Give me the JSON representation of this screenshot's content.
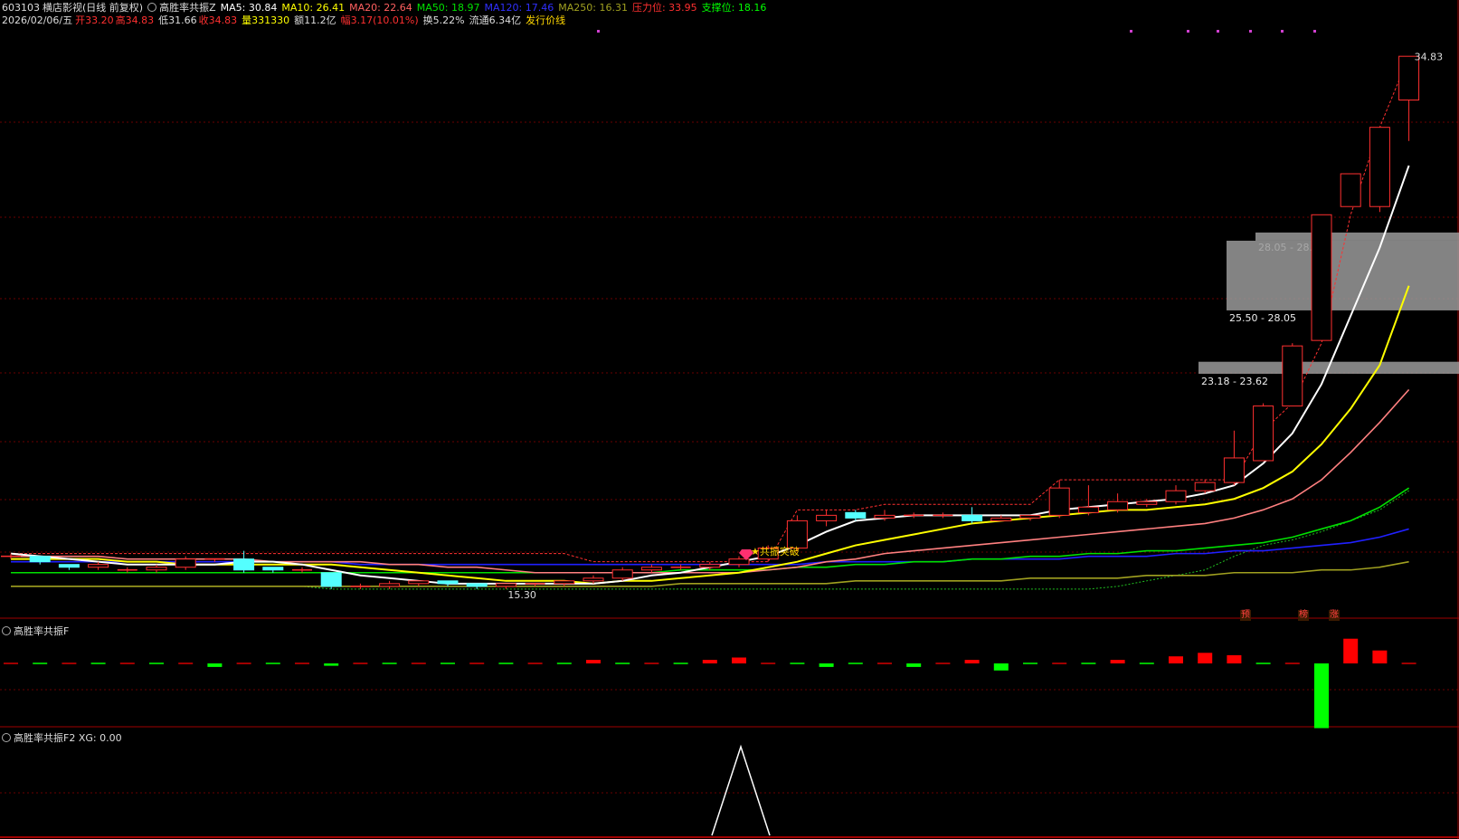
{
  "header": {
    "code": "603103",
    "name": "横店影视",
    "mode": "(日线 前复权)",
    "indicator": "高胜率共振Z",
    "ma5": "MA5: 30.84",
    "ma10": "MA10: 26.41",
    "ma20": "MA20: 22.64",
    "ma50": "MA50: 18.97",
    "ma120": "MA120: 17.46",
    "ma250": "MA250: 16.31",
    "resistance": "压力位: 33.95",
    "support": "支撑位: 18.16",
    "date": "2026/02/06/五",
    "open": "开33.20",
    "high": "高34.83",
    "low": "低31.66",
    "close": "收34.83",
    "volume": "量331330",
    "amount": "额11.2亿",
    "change": "幅3.17(10.01%)",
    "turnover": "换5.22%",
    "float": "流通6.34亿",
    "issue_line": "发行价线"
  },
  "colors": {
    "ma5": "#ffffff",
    "ma10": "#ffff00",
    "ma20": "#ff8080",
    "ma50": "#00e000",
    "ma120": "#2020ff",
    "ma250": "#a0a020",
    "up": "#ff3030",
    "down": "#54ffff",
    "grid": "#6a0000",
    "zone": "#9a9a9a"
  },
  "panels": {
    "sub1_title": "高胜率共振F",
    "sub2_title": "高胜率共振F2 XG: 0.00"
  },
  "chart_data": {
    "type": "candlestick",
    "price_labels": {
      "high": "34.83",
      "low": "15.30"
    },
    "zones": [
      {
        "label": "28.05 - 28.35",
        "lo": 28.05,
        "hi": 28.35
      },
      {
        "label": "25.50 - 28.05",
        "lo": 25.5,
        "hi": 28.05
      },
      {
        "label": "23.18 - 23.62",
        "lo": 23.18,
        "hi": 23.62
      }
    ],
    "signal_label": "共振突破",
    "tags": [
      "预",
      "榜",
      "涨"
    ],
    "candles": [
      [
        16.5,
        16.5,
        16.6,
        16.4
      ],
      [
        16.5,
        16.3,
        16.5,
        16.2
      ],
      [
        16.2,
        16.1,
        16.2,
        16.0
      ],
      [
        16.1,
        16.2,
        16.3,
        16.0
      ],
      [
        16.0,
        16.0,
        16.1,
        15.9
      ],
      [
        16.0,
        16.1,
        16.2,
        15.9
      ],
      [
        16.1,
        16.4,
        16.5,
        16.0
      ],
      [
        16.4,
        16.4,
        16.4,
        16.3
      ],
      [
        16.4,
        16.0,
        16.7,
        15.9
      ],
      [
        16.1,
        16.0,
        16.1,
        15.9
      ],
      [
        16.0,
        16.0,
        16.1,
        15.9
      ],
      [
        15.9,
        15.4,
        15.9,
        15.3
      ],
      [
        15.4,
        15.4,
        15.5,
        15.3
      ],
      [
        15.4,
        15.5,
        15.6,
        15.3
      ],
      [
        15.5,
        15.6,
        15.6,
        15.4
      ],
      [
        15.6,
        15.5,
        15.6,
        15.4
      ],
      [
        15.5,
        15.4,
        15.5,
        15.3
      ],
      [
        15.4,
        15.5,
        15.5,
        15.3
      ],
      [
        15.5,
        15.5,
        15.5,
        15.4
      ],
      [
        15.5,
        15.6,
        15.6,
        15.4
      ],
      [
        15.6,
        15.7,
        15.8,
        15.5
      ],
      [
        15.7,
        16.0,
        16.1,
        15.6
      ],
      [
        16.0,
        16.1,
        16.2,
        15.9
      ],
      [
        16.1,
        16.1,
        16.2,
        16.0
      ],
      [
        16.1,
        16.2,
        16.3,
        16.0
      ],
      [
        16.2,
        16.4,
        16.5,
        16.1
      ],
      [
        16.4,
        16.8,
        16.9,
        16.3
      ],
      [
        16.8,
        17.8,
        18.0,
        16.7
      ],
      [
        17.8,
        18.0,
        18.2,
        17.6
      ],
      [
        18.1,
        17.9,
        18.2,
        17.8
      ],
      [
        17.9,
        18.0,
        18.2,
        17.8
      ],
      [
        18.0,
        18.0,
        18.1,
        17.9
      ],
      [
        18.0,
        18.0,
        18.1,
        17.9
      ],
      [
        18.0,
        17.8,
        18.3,
        17.7
      ],
      [
        17.8,
        17.9,
        18.0,
        17.8
      ],
      [
        17.9,
        18.0,
        18.0,
        17.8
      ],
      [
        18.0,
        19.0,
        19.3,
        17.9
      ],
      [
        18.1,
        18.3,
        19.1,
        18.0
      ],
      [
        18.2,
        18.5,
        18.8,
        18.1
      ],
      [
        18.4,
        18.5,
        18.6,
        18.3
      ],
      [
        18.5,
        18.9,
        19.1,
        18.4
      ],
      [
        18.9,
        19.2,
        19.3,
        18.8
      ],
      [
        19.2,
        20.1,
        21.1,
        19.1
      ],
      [
        20.0,
        22.0,
        22.1,
        20.0
      ],
      [
        22.0,
        24.2,
        24.3,
        22.0
      ],
      [
        24.4,
        29.0,
        29.0,
        28.0
      ],
      [
        29.3,
        30.5,
        30.5,
        30.5
      ],
      [
        29.3,
        32.2,
        32.2,
        29.1
      ],
      [
        33.2,
        34.8,
        34.8,
        31.7
      ]
    ],
    "ma5": [
      16.6,
      16.5,
      16.4,
      16.3,
      16.2,
      16.2,
      16.2,
      16.2,
      16.3,
      16.3,
      16.2,
      16.0,
      15.8,
      15.7,
      15.6,
      15.5,
      15.5,
      15.5,
      15.5,
      15.5,
      15.5,
      15.6,
      15.8,
      15.9,
      16.1,
      16.3,
      16.5,
      16.9,
      17.4,
      17.8,
      17.9,
      18.0,
      18.0,
      18.0,
      18.0,
      18.0,
      18.2,
      18.3,
      18.4,
      18.5,
      18.6,
      18.8,
      19.1,
      19.9,
      21.0,
      22.8,
      25.3,
      27.8,
      30.8
    ],
    "ma10": [
      16.4,
      16.4,
      16.4,
      16.4,
      16.3,
      16.3,
      16.2,
      16.2,
      16.2,
      16.2,
      16.2,
      16.2,
      16.1,
      16.0,
      15.9,
      15.8,
      15.7,
      15.6,
      15.6,
      15.6,
      15.5,
      15.6,
      15.6,
      15.7,
      15.8,
      15.9,
      16.1,
      16.3,
      16.6,
      16.9,
      17.1,
      17.3,
      17.5,
      17.7,
      17.8,
      17.9,
      18.0,
      18.1,
      18.2,
      18.2,
      18.3,
      18.4,
      18.6,
      19.0,
      19.6,
      20.6,
      21.9,
      23.5,
      26.4
    ],
    "ma20": [
      16.5,
      16.5,
      16.5,
      16.5,
      16.4,
      16.4,
      16.4,
      16.4,
      16.4,
      16.3,
      16.3,
      16.3,
      16.3,
      16.2,
      16.2,
      16.1,
      16.1,
      16.0,
      15.9,
      15.9,
      15.9,
      15.9,
      15.9,
      15.9,
      15.9,
      15.9,
      16.0,
      16.1,
      16.3,
      16.4,
      16.6,
      16.7,
      16.8,
      16.9,
      17.0,
      17.1,
      17.2,
      17.3,
      17.4,
      17.5,
      17.6,
      17.7,
      17.9,
      18.2,
      18.6,
      19.3,
      20.3,
      21.4,
      22.6
    ],
    "ma50": [
      15.9,
      15.9,
      15.9,
      15.9,
      15.9,
      15.9,
      15.9,
      15.9,
      15.9,
      15.9,
      15.9,
      15.9,
      15.9,
      15.9,
      15.9,
      15.9,
      15.9,
      15.9,
      15.9,
      15.9,
      15.9,
      15.9,
      15.9,
      16.0,
      16.0,
      16.0,
      16.0,
      16.1,
      16.1,
      16.2,
      16.2,
      16.3,
      16.3,
      16.4,
      16.4,
      16.5,
      16.5,
      16.6,
      16.6,
      16.7,
      16.7,
      16.8,
      16.9,
      17.0,
      17.2,
      17.5,
      17.8,
      18.3,
      19.0
    ],
    "ma120": [
      16.3,
      16.3,
      16.3,
      16.3,
      16.3,
      16.3,
      16.3,
      16.3,
      16.3,
      16.3,
      16.3,
      16.3,
      16.2,
      16.2,
      16.2,
      16.2,
      16.2,
      16.2,
      16.2,
      16.2,
      16.2,
      16.2,
      16.2,
      16.2,
      16.2,
      16.2,
      16.2,
      16.2,
      16.3,
      16.3,
      16.3,
      16.3,
      16.3,
      16.4,
      16.4,
      16.4,
      16.4,
      16.5,
      16.5,
      16.5,
      16.6,
      16.6,
      16.7,
      16.7,
      16.8,
      16.9,
      17.0,
      17.2,
      17.5
    ],
    "ma250": [
      15.4,
      15.4,
      15.4,
      15.4,
      15.4,
      15.4,
      15.4,
      15.4,
      15.4,
      15.4,
      15.4,
      15.4,
      15.4,
      15.4,
      15.4,
      15.4,
      15.4,
      15.4,
      15.4,
      15.4,
      15.4,
      15.4,
      15.4,
      15.5,
      15.5,
      15.5,
      15.5,
      15.5,
      15.5,
      15.6,
      15.6,
      15.6,
      15.6,
      15.6,
      15.6,
      15.7,
      15.7,
      15.7,
      15.7,
      15.8,
      15.8,
      15.8,
      15.9,
      15.9,
      15.9,
      16.0,
      16.0,
      16.1,
      16.3
    ],
    "sub1_values": [
      0,
      0,
      0,
      0,
      0,
      0,
      0,
      -0.3,
      0,
      0,
      0,
      -0.2,
      0,
      0,
      0,
      0,
      0,
      0,
      0,
      0,
      0.3,
      0,
      0,
      0,
      0.3,
      0.5,
      0,
      0,
      -0.3,
      0,
      0,
      -0.3,
      0,
      0.3,
      -0.6,
      0,
      0,
      0,
      0.3,
      0,
      0.6,
      0.9,
      0.7,
      0,
      0,
      -5.5,
      2.1,
      1.1,
      0
    ],
    "sub2_peak_index": 25
  }
}
